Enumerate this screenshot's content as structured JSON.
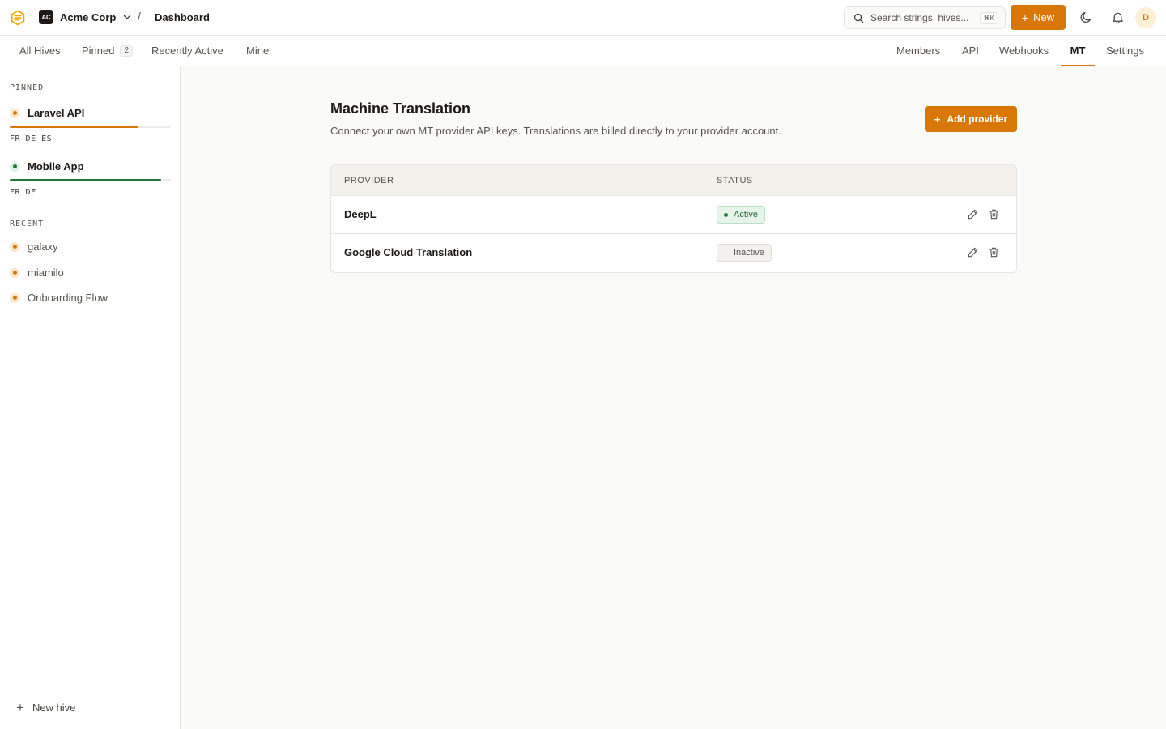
{
  "header": {
    "org_initials": "AC",
    "org_name": "Acme Corp",
    "breadcrumb_separator": "/",
    "breadcrumb": "Dashboard",
    "search_placeholder": "Search strings, hives...",
    "search_shortcut": "⌘K",
    "new_button": "New",
    "avatar_initial": "D"
  },
  "nav": {
    "left_tabs": [
      {
        "label": "All Hives"
      },
      {
        "label": "Pinned",
        "count": "2"
      },
      {
        "label": "Recently Active"
      },
      {
        "label": "Mine"
      }
    ],
    "right_tabs": [
      {
        "label": "Members"
      },
      {
        "label": "API"
      },
      {
        "label": "Webhooks"
      },
      {
        "label": "MT",
        "active": true
      },
      {
        "label": "Settings"
      }
    ]
  },
  "sidebar": {
    "pinned_label": "PINNED",
    "pinned": [
      {
        "name": "Laravel API",
        "langs": "FR DE ES",
        "progress": 0.8,
        "color": "#d97706"
      },
      {
        "name": "Mobile App",
        "langs": "FR DE",
        "progress": 0.94,
        "color": "#1f7a3a"
      }
    ],
    "recent_label": "RECENT",
    "recent": [
      {
        "name": "galaxy"
      },
      {
        "name": "miamilo"
      },
      {
        "name": "Onboarding Flow"
      }
    ],
    "new_hive": "New hive"
  },
  "main": {
    "title": "Machine Translation",
    "description": "Connect your own MT provider API keys. Translations are billed directly to your provider account.",
    "add_button": "Add provider",
    "table": {
      "headers": [
        "PROVIDER",
        "STATUS"
      ],
      "rows": [
        {
          "provider": "DeepL",
          "status": "Active"
        },
        {
          "provider": "Google Cloud Translation",
          "status": "Inactive"
        }
      ]
    }
  },
  "colors": {
    "accent": "#d97706",
    "success": "#1f7a3a"
  }
}
